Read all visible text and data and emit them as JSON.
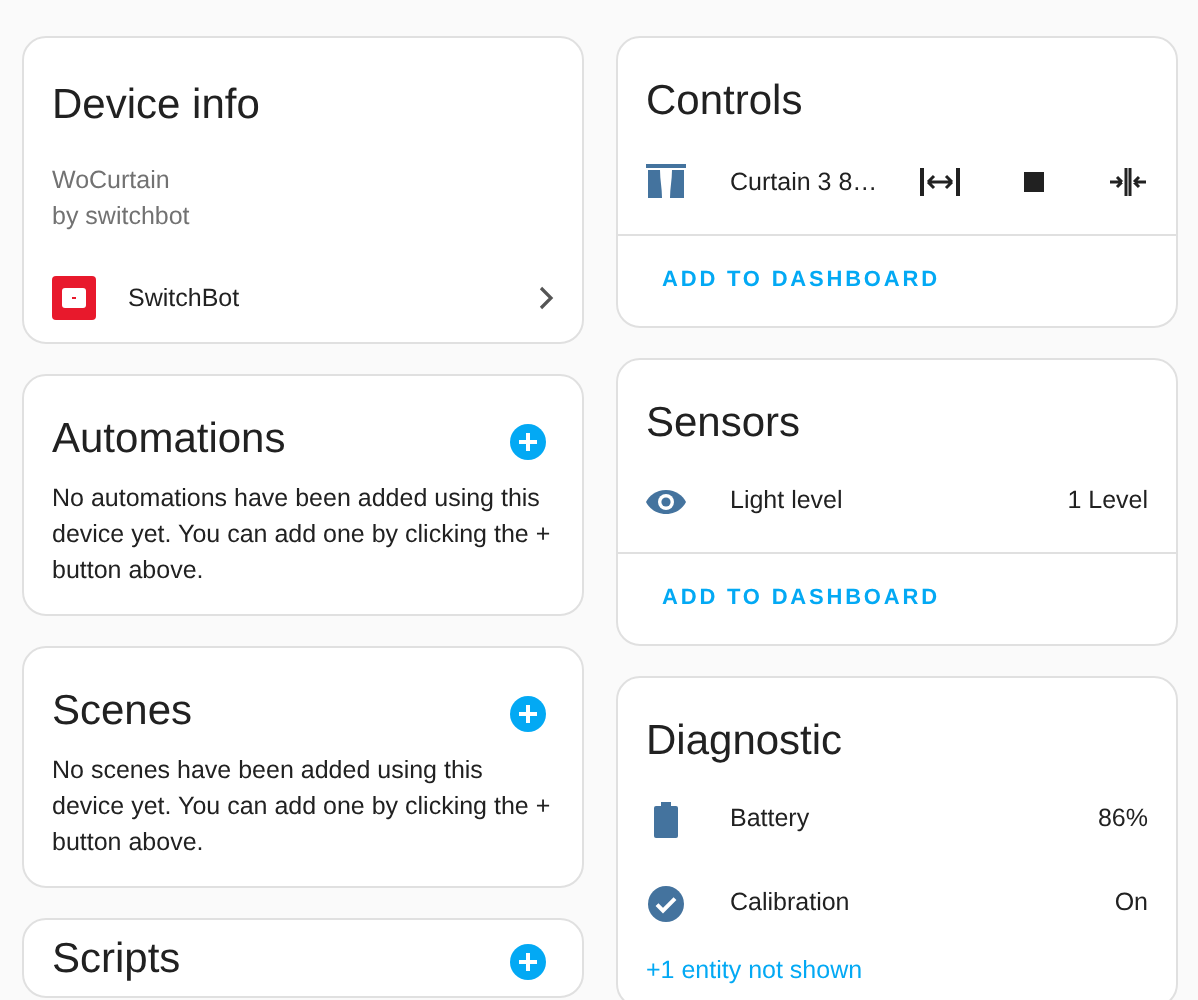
{
  "left_column": [
    {
      "kind": "info",
      "title": "Device info",
      "model": "WoCurtain",
      "manufacturer": "by switchbot",
      "integration": "SwitchBot"
    },
    {
      "kind": "empty",
      "title": "Automations",
      "message": "No automations have been added using this device yet. You can add one by clicking the + button above."
    },
    {
      "kind": "empty",
      "title": "Scenes",
      "message": "No scenes have been added using this device yet. You can add one by clicking the + button above."
    },
    {
      "kind": "empty",
      "title": "Scripts"
    }
  ],
  "right_column": [
    {
      "kind": "entities",
      "title": "Controls",
      "rows": [
        {
          "kind": "cover",
          "name": "Curtain 3 8…"
        }
      ],
      "footer": {
        "kind": "button",
        "label": "ADD TO DASHBOARD"
      }
    },
    {
      "kind": "entities",
      "title": "Sensors",
      "rows": [
        {
          "kind": "illuminance",
          "name": "Light level",
          "value": "1 Level"
        }
      ],
      "footer": {
        "kind": "button",
        "label": "ADD TO DASHBOARD"
      }
    },
    {
      "kind": "entities",
      "title": "Diagnostic",
      "rows": [
        {
          "kind": "battery",
          "name": "Battery",
          "value": "86%"
        },
        {
          "kind": "check",
          "name": "Calibration",
          "value": "On"
        }
      ],
      "footer": {
        "kind": "link",
        "label": "+1 entity not shown"
      }
    }
  ]
}
